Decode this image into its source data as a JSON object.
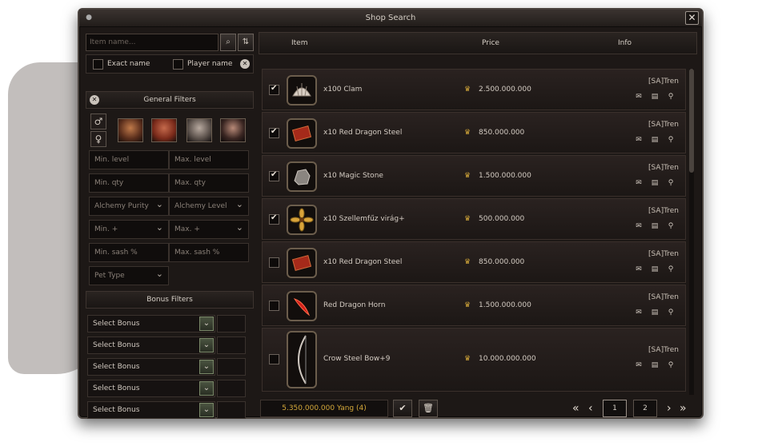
{
  "window": {
    "title": "Shop Search"
  },
  "left": {
    "search": {
      "placeholder": "Item name..."
    },
    "exact_name_label": "Exact name",
    "player_name_label": "Player name",
    "general_filters_title": "General Filters",
    "fields": {
      "min_level": "Min. level",
      "max_level": "Max. level",
      "min_qty": "Min. qty",
      "max_qty": "Max. qty",
      "alchemy_purity": "Alchemy Purity",
      "alchemy_level": "Alchemy Level",
      "min_plus": "Min. +",
      "max_plus": "Max. +",
      "min_sash": "Min. sash %",
      "max_sash": "Max. sash %",
      "pet_type": "Pet Type"
    },
    "bonus_filters_title": "Bonus Filters",
    "bonus_rows": [
      "Select Bonus",
      "Select Bonus",
      "Select Bonus",
      "Select Bonus",
      "Select Bonus"
    ]
  },
  "columns": {
    "item": "Item",
    "price": "Price",
    "info": "Info"
  },
  "rows": [
    {
      "name": "x100 Clam",
      "price": "2.500.000.000",
      "seller": "[SA]Tren",
      "checked": true,
      "icon": "clam-icon"
    },
    {
      "name": "x10 Red Dragon Steel",
      "price": "850.000.000",
      "seller": "[SA]Tren",
      "checked": true,
      "icon": "red-dragon-steel-icon"
    },
    {
      "name": "x10 Magic Stone",
      "price": "1.500.000.000",
      "seller": "[SA]Tren",
      "checked": true,
      "icon": "magic-stone-icon"
    },
    {
      "name": "x10 Szellemfűz virág+",
      "price": "500.000.000",
      "seller": "[SA]Tren",
      "checked": true,
      "icon": "flower-icon"
    },
    {
      "name": "x10 Red Dragon Steel",
      "price": "850.000.000",
      "seller": "[SA]Tren",
      "checked": false,
      "icon": "red-dragon-steel-icon"
    },
    {
      "name": "Red Dragon Horn",
      "price": "1.500.000.000",
      "seller": "[SA]Tren",
      "checked": false,
      "icon": "red-dragon-horn-icon"
    },
    {
      "name": "Crow Steel Bow+9",
      "price": "10.000.000.000",
      "seller": "[SA]Tren",
      "checked": false,
      "icon": "bow-icon"
    }
  ],
  "footer": {
    "total": "5.350.000.000 Yang (4)",
    "pages": [
      "1",
      "2"
    ],
    "current_page": "1"
  }
}
